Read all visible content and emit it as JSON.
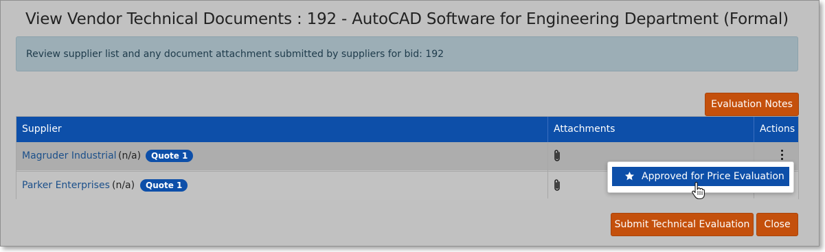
{
  "dialog": {
    "title": "View Vendor Technical Documents : 192 - AutoCAD Software for Engineering Department (Formal)",
    "info_message": "Review supplier list and any document attachment submitted by suppliers for bid: 192",
    "evaluation_notes_label": "Evaluation Notes"
  },
  "table": {
    "headers": {
      "supplier": "Supplier",
      "attachments": "Attachments",
      "actions": "Actions"
    },
    "rows": [
      {
        "supplier": "Magruder Industrial",
        "na": "(n/a)",
        "badge": "Quote 1",
        "attachment_icon": "paperclip-icon",
        "actions_icon": "kebab-menu-icon"
      },
      {
        "supplier": "Parker Enterprises",
        "na": "(n/a)",
        "badge": "Quote 1",
        "attachment_icon": "paperclip-icon",
        "actions_icon": "kebab-menu-icon"
      }
    ]
  },
  "actions_menu": {
    "item_label": "Approved for Price Evaluation",
    "item_icon": "star-icon"
  },
  "footer": {
    "submit_label": "Submit Technical Evaluation",
    "close_label": "Close"
  },
  "colors": {
    "header_blue": "#0d4fa9",
    "button_orange": "#c4500c",
    "info_bg": "#9caeb6",
    "overlay_gray": "#c1c1c1"
  }
}
